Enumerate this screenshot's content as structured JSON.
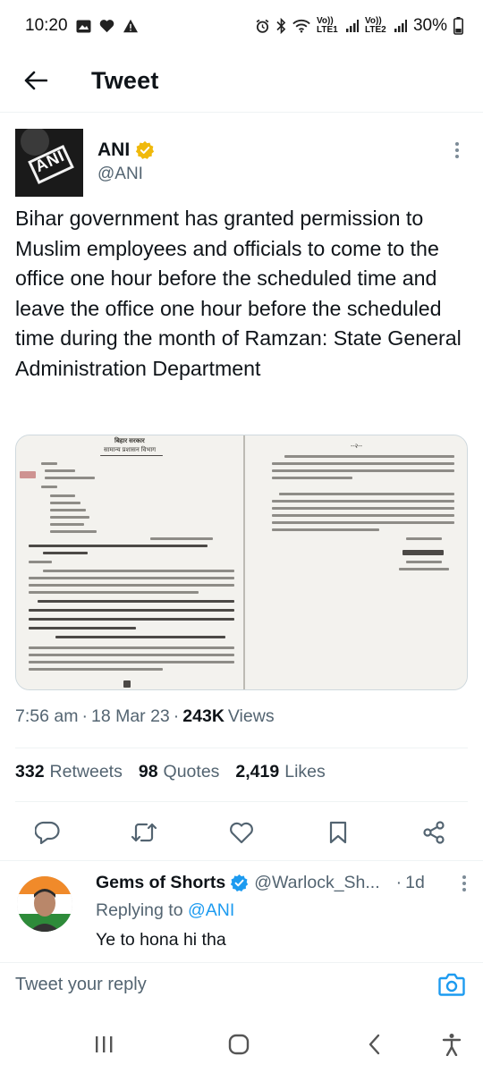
{
  "status_bar": {
    "time": "10:20",
    "network_1": "Vo)) LTE1",
    "network_2": "Vo)) LTE2",
    "battery": "30%"
  },
  "header": {
    "title": "Tweet"
  },
  "tweet": {
    "author_name": "ANI",
    "author_handle": "@ANI",
    "verified": true,
    "avatar_text": "ANI",
    "text": "Bihar government has granted permission to Muslim employees and officials to come to the office one hour before the scheduled time and leave the office one hour before the scheduled time during the month of Ramzan: State General Administration Department",
    "time": "7:56 am",
    "date": "18 Mar 23",
    "views_count": "243K",
    "views_label": "Views",
    "retweets_count": "332",
    "retweets_label": "Retweets",
    "quotes_count": "98",
    "quotes_label": "Quotes",
    "likes_count": "2,419",
    "likes_label": "Likes"
  },
  "document": {
    "left_title": "बिहार सरकार",
    "left_subtitle": "सामान्य प्रशासन विभाग",
    "right_header": "--२--"
  },
  "reply": {
    "name": "Gems of Shorts",
    "handle": "@Warlock_Sh...",
    "time": "1d",
    "replying_prefix": "Replying to",
    "replying_to": "@ANI",
    "text": "Ye to hona hi tha"
  },
  "compose": {
    "placeholder": "Tweet your reply"
  },
  "colors": {
    "accent": "#1d9bf0",
    "verified": "#f0b90b",
    "text": "#0f1419",
    "secondary": "#536471"
  }
}
